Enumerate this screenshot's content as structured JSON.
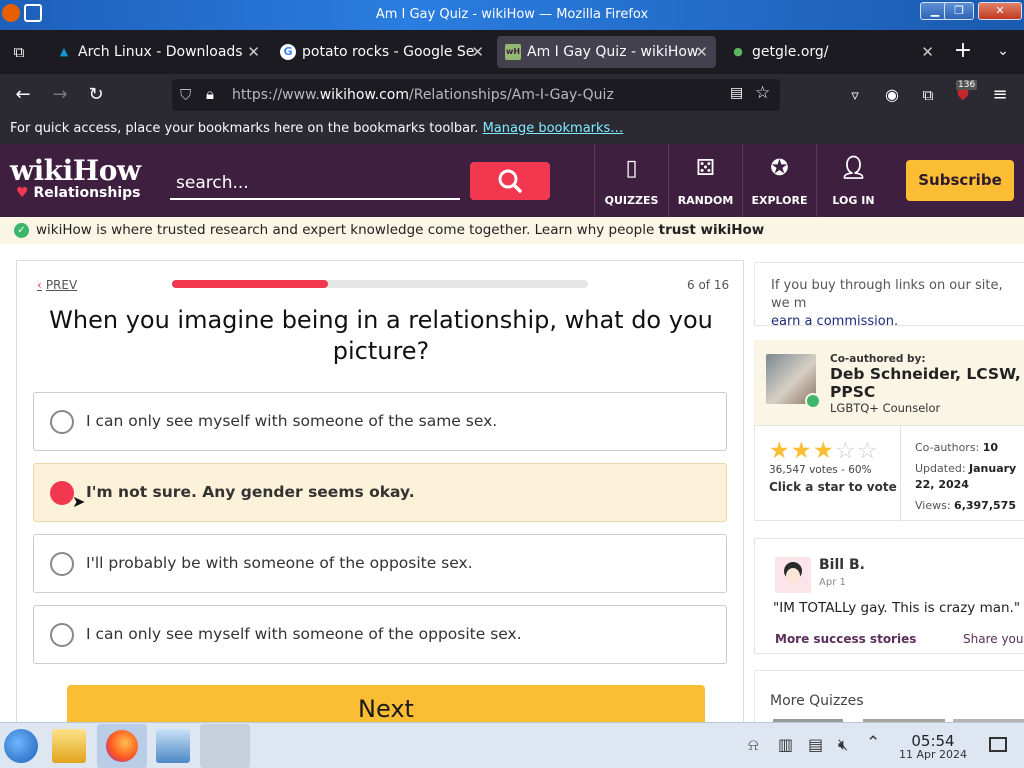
{
  "window": {
    "title": "Am I Gay Quiz - wikiHow — Mozilla Firefox"
  },
  "tabs": [
    {
      "label": "Arch Linux - Downloads",
      "icon": "arch-linux-icon",
      "active": false
    },
    {
      "label": "potato rocks - Google Se",
      "icon": "google-icon",
      "active": false
    },
    {
      "label": "Am I Gay Quiz - wikiHow",
      "icon": "wikihow-icon",
      "active": true
    },
    {
      "label": "getgle.org/",
      "icon": "getgle-icon",
      "active": false
    }
  ],
  "navbar": {
    "url_prefix": "https://www.",
    "url_domain": "wikihow.com",
    "url_path": "/Relationships/Am-I-Gay-Quiz",
    "extension_badge": "136"
  },
  "bookmarks_bar": {
    "message": "For quick access, place your bookmarks here on the bookmarks toolbar.",
    "link": "Manage bookmarks…"
  },
  "site_header": {
    "logo": "wikiHow",
    "category": "Relationships",
    "search_placeholder": "search...",
    "nav": [
      {
        "label": "QUIZZES",
        "icon": "quizzes-icon"
      },
      {
        "label": "RANDOM",
        "icon": "dice-icon"
      },
      {
        "label": "EXPLORE",
        "icon": "compass-icon"
      },
      {
        "label": "LOG IN",
        "icon": "user-icon"
      }
    ],
    "subscribe_label": "Subscribe"
  },
  "trust_bar": {
    "text": "wikiHow is where trusted research and expert knowledge come together. Learn why people ",
    "emphasis": "trust wikiHow"
  },
  "quiz": {
    "prev_label": "PREV",
    "progress_fraction": 0.375,
    "counter": "6 of 16",
    "question": "When you imagine being in a relationship, what do you picture?",
    "options": [
      {
        "text": "I can only see myself with someone of the same sex.",
        "selected": false
      },
      {
        "text": "I'm not sure. Any gender seems okay.",
        "selected": true
      },
      {
        "text": "I'll probably be with someone of the opposite sex.",
        "selected": false
      },
      {
        "text": "I can only see myself with someone of the opposite sex.",
        "selected": false
      }
    ],
    "next_label": "Next"
  },
  "sidebar": {
    "disclosure_text": "If you buy through links on our site, we m",
    "disclosure_link": "earn a commission.",
    "author": {
      "coauthored_label": "Co-authored by:",
      "name": "Deb Schneider, LCSW, PPSC",
      "role": "LGBTQ+ Counselor"
    },
    "rating": {
      "stars": 3,
      "votes": "36,547 votes - 60%",
      "cta": "Click a star to vote"
    },
    "meta": {
      "coauthors_label": "Co-authors: ",
      "coauthors": "10",
      "updated_label": "Updated: ",
      "updated": "January 22, 2024",
      "views_label": "Views: ",
      "views": "6,397,575"
    },
    "story": {
      "user": "Bill B.",
      "date": "Apr 1",
      "quote": "\"IM TOTALLy gay. This is crazy man.\"",
      "more_link": "More success stories",
      "share_link": "Share your"
    },
    "more_quizzes": "More Quizzes"
  },
  "taskbar": {
    "time": "05:54",
    "date": "11 Apr 2024"
  }
}
